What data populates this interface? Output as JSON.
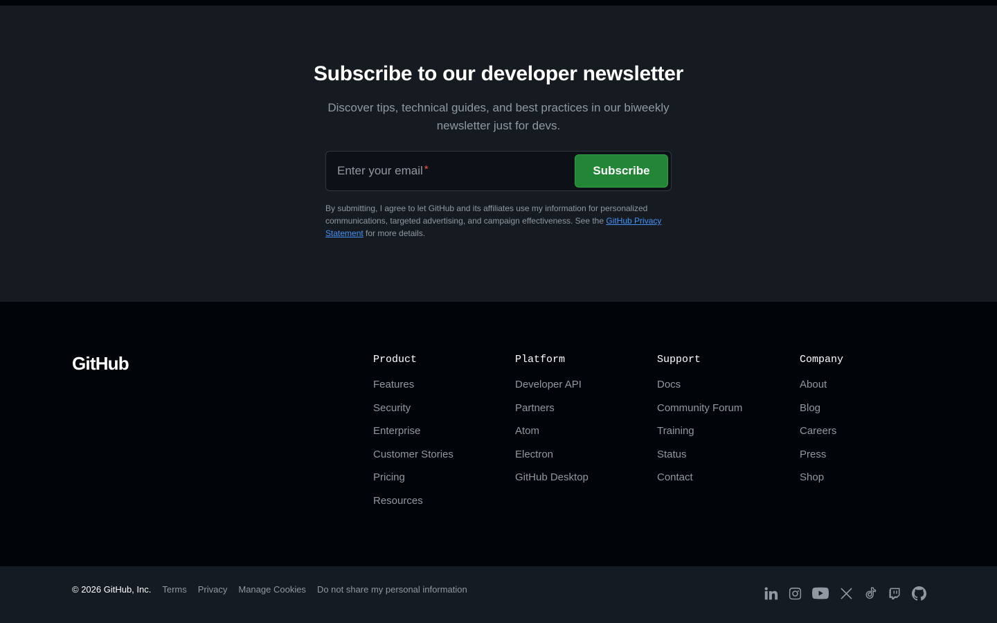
{
  "newsletter": {
    "title": "Subscribe to our developer newsletter",
    "subtitle": "Discover tips, technical guides, and best practices in our biweekly newsletter just for devs.",
    "email_placeholder": "Enter your email",
    "required_mark": "*",
    "subscribe_label": "Subscribe",
    "legal_prefix": "By submitting, I agree to let GitHub and its affiliates use my information for personalized communications, targeted advertising, and campaign effectiveness. See the ",
    "legal_link": "GitHub Privacy Statement",
    "legal_suffix": " for more details."
  },
  "footer": {
    "logo": "GitHub",
    "columns": [
      {
        "title": "Product",
        "links": [
          "Features",
          "Security",
          "Enterprise",
          "Customer Stories",
          "Pricing",
          "Resources"
        ]
      },
      {
        "title": "Platform",
        "links": [
          "Developer API",
          "Partners",
          "Atom",
          "Electron",
          "GitHub Desktop"
        ]
      },
      {
        "title": "Support",
        "links": [
          "Docs",
          "Community Forum",
          "Training",
          "Status",
          "Contact"
        ]
      },
      {
        "title": "Company",
        "links": [
          "About",
          "Blog",
          "Careers",
          "Press",
          "Shop"
        ]
      }
    ]
  },
  "bottom": {
    "copyright": "© 2026 GitHub, Inc.",
    "links": [
      "Terms",
      "Privacy",
      "Manage Cookies",
      "Do not share my personal information"
    ],
    "social_icons": [
      "linkedin-icon",
      "instagram-icon",
      "youtube-icon",
      "x-icon",
      "tiktok-icon",
      "twitch-icon",
      "github-icon"
    ]
  },
  "colors": {
    "background": "#010409",
    "newsletter_bg": "#161b22",
    "accent_green": "#238636",
    "link_blue": "#4493f8",
    "muted_text": "#9198a1"
  }
}
